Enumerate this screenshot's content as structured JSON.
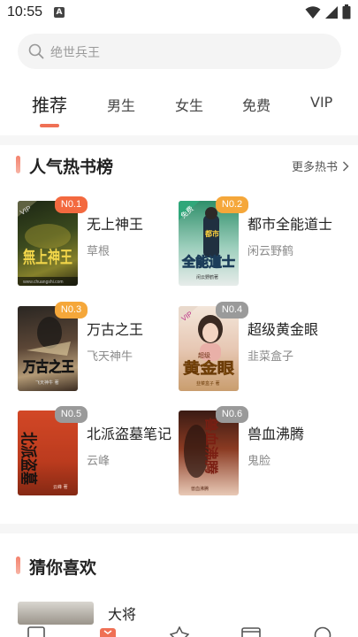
{
  "status": {
    "time": "10:55",
    "indicator": "A"
  },
  "search": {
    "placeholder": "绝世兵王"
  },
  "tabs": [
    {
      "label": "推荐",
      "active": true
    },
    {
      "label": "男生"
    },
    {
      "label": "女生"
    },
    {
      "label": "免费"
    },
    {
      "label": "VIP"
    }
  ],
  "hot": {
    "title": "人气热书榜",
    "more": "更多热书",
    "books": [
      {
        "rank": "N0.1",
        "title": "无上神王",
        "author": "草根",
        "cover_tag": "VIP",
        "cover_text": "無上神王",
        "cover_sub": "www.chuangshi.com"
      },
      {
        "rank": "N0.2",
        "title": "都市全能道士",
        "author": "闲云野鹤",
        "cover_tag": "免费",
        "cover_text": "全能道士",
        "cover_top": "都市",
        "cover_sub": "闲云野鹤著"
      },
      {
        "rank": "N0.3",
        "title": "万古之王",
        "author": "飞天神牛",
        "cover_text": "万古之王",
        "cover_sub": "飞天神牛 著"
      },
      {
        "rank": "N0.4",
        "title": "超级黄金眼",
        "author": "韭菜盒子",
        "cover_tag": "VIP",
        "cover_text": "黄金眼",
        "cover_top": "超级",
        "cover_sub": "韭菜盒子 著"
      },
      {
        "rank": "N0.5",
        "title": "北派盗墓笔记",
        "author": "云峰",
        "cover_text": "北派盗墓",
        "cover_sub": "云峰 著"
      },
      {
        "rank": "N0.6",
        "title": "兽血沸腾",
        "author": "鬼脸",
        "cover_text": "兽血沸腾",
        "cover_sub": "兽血沸腾"
      }
    ]
  },
  "guess": {
    "title": "猜你喜欢",
    "first_title": "大将"
  },
  "colors": {
    "accent": "#ef7055",
    "badge_hot": "#f3693f",
    "badge_warm": "#f5a73a",
    "badge_gray": "#9a9a9a"
  },
  "nav_icons": [
    "bookshelf-icon",
    "bookstore-icon",
    "rank-icon",
    "category-icon",
    "profile-icon"
  ]
}
